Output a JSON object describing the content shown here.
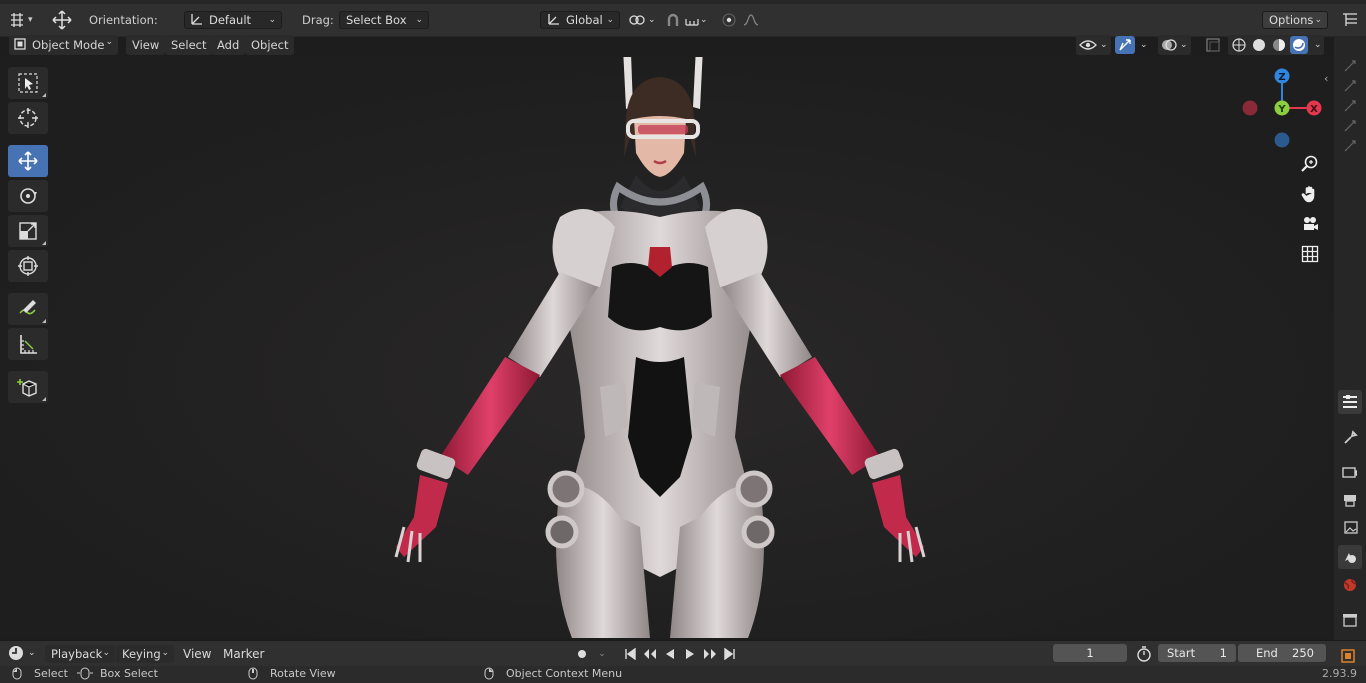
{
  "header": {
    "orientation_label": "Orientation:",
    "orientation_value": "Default",
    "drag_label": "Drag:",
    "drag_value": "Select Box",
    "transform_space": "Global",
    "options_label": "Options"
  },
  "viewport_header": {
    "mode": "Object Mode",
    "menus": [
      "View",
      "Select",
      "Add",
      "Object"
    ]
  },
  "gizmo": {
    "axes": [
      "Z",
      "Y",
      "X"
    ],
    "colors": {
      "x": "#e2374f",
      "y": "#8bce3e",
      "z": "#2f86e0",
      "neg_x": "#8a2a38",
      "neg_z": "#2a5a8e"
    }
  },
  "tools": [
    "select-box",
    "cursor",
    "move",
    "rotate",
    "scale",
    "transform",
    "annotate",
    "measure",
    "add-cube"
  ],
  "timeline": {
    "editor_menus": [
      "Playback",
      "Keying",
      "View",
      "Marker"
    ],
    "current_frame": "1",
    "start_label": "Start",
    "start_value": "1",
    "end_label": "End",
    "end_value": "250"
  },
  "statusbar": {
    "select": "Select",
    "box_select": "Box Select",
    "rotate_view": "Rotate View",
    "context_menu": "Object Context Menu",
    "version": "2.93.9"
  },
  "colors": {
    "accent": "#4772b3",
    "suit_red": "#c8284e",
    "suit_white": "#cfc8c8"
  }
}
